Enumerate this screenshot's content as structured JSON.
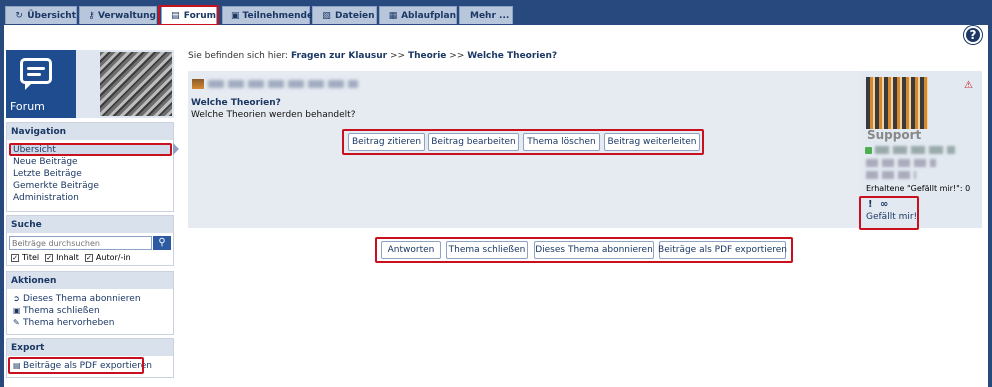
{
  "tabs": [
    {
      "label": "Übersicht",
      "icon": "dashboard-icon",
      "glyph": "↻"
    },
    {
      "label": "Verwaltung",
      "icon": "key-icon",
      "glyph": "⚷"
    },
    {
      "label": "Forum",
      "icon": "speech-bubble-icon",
      "glyph": "▤"
    },
    {
      "label": "Teilnehmende",
      "icon": "users-icon",
      "glyph": "▣"
    },
    {
      "label": "Dateien",
      "icon": "file-icon",
      "glyph": "▧"
    },
    {
      "label": "Ablaufplan",
      "icon": "calendar-icon",
      "glyph": "▦"
    },
    {
      "label": "Mehr ...",
      "icon": "",
      "glyph": ""
    }
  ],
  "help_icon": "?",
  "forum_banner_title": "Forum",
  "navigation": {
    "heading": "Navigation",
    "items": [
      "Übersicht",
      "Neue Beiträge",
      "Letzte Beiträge",
      "Gemerkte Beiträge",
      "Administration"
    ]
  },
  "search": {
    "heading": "Suche",
    "placeholder": "Beiträge durchsuchen",
    "options": [
      "Titel",
      "Inhalt",
      "Autor/-in"
    ]
  },
  "actions": {
    "heading": "Aktionen",
    "items": [
      "Dieses Thema abonnieren",
      "Thema schließen",
      "Thema hervorheben"
    ]
  },
  "export": {
    "heading": "Export",
    "item": "Beiträge als PDF exportieren"
  },
  "breadcrumb": {
    "prefix": "Sie befinden sich hier:",
    "parts": [
      "Fragen zur Klausur",
      "Theorie",
      "Welche Theorien?"
    ],
    "sep": ">>"
  },
  "post": {
    "title": "Welche Theorien?",
    "body": "Welche Theorien werden behandelt?",
    "buttons": [
      "Beitrag zitieren",
      "Beitrag bearbeiten",
      "Thema löschen",
      "Beitrag weiterleiten"
    ]
  },
  "author": {
    "badge": "Support",
    "likes_received": "Erhaltene \"Gefällt mir!\": 0",
    "like_label": "Gefällt mir!",
    "mark_icon": "!",
    "link_icon": "∞"
  },
  "bottom_buttons": [
    "Antworten",
    "Thema schließen",
    "Dieses Thema abonnieren",
    "Beiträge als PDF exportieren"
  ]
}
